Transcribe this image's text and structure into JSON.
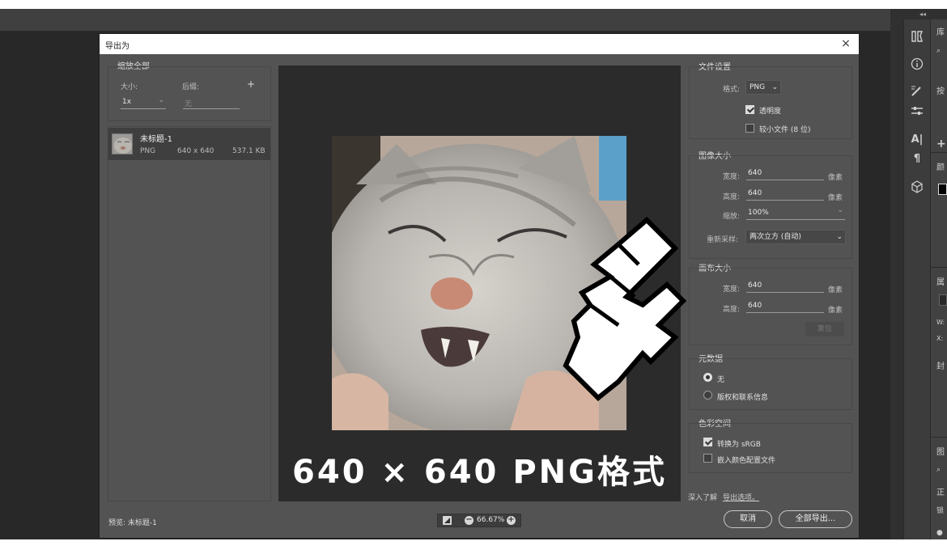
{
  "dialog": {
    "title": "导出为",
    "close": "×"
  },
  "left_panel": {
    "header": "缩放全部",
    "size_label": "大小:",
    "suffix_label": "后缀:",
    "add": "+",
    "scale_value": "1x",
    "suffix_value": "无",
    "asset": {
      "name": "未标题-1",
      "format": "PNG",
      "dimensions": "640 x 640",
      "filesize": "537.1 KB"
    }
  },
  "preview": {
    "label": "预览: 未标题-1",
    "zoom": "66.67%",
    "overlay": "640 × 640 PNG格式"
  },
  "file_settings": {
    "header": "文件设置",
    "format_label": "格式:",
    "format_value": "PNG",
    "transparency": "透明度",
    "smaller_file": "较小文件 (8 位)"
  },
  "image_size": {
    "header": "图像大小",
    "width_label": "宽度:",
    "width_value": "640",
    "height_label": "高度:",
    "height_value": "640",
    "scale_label": "缩放:",
    "scale_value": "100%",
    "unit": "像素",
    "resample_label": "重新采样:",
    "resample_value": "两次立方 (自动)"
  },
  "canvas_size": {
    "header": "画布大小",
    "width_label": "宽度:",
    "width_value": "640",
    "height_label": "高度:",
    "height_value": "640",
    "unit": "像素",
    "reset": "复位"
  },
  "metadata": {
    "header": "元数据",
    "none": "无",
    "copyright": "版权和联系信息"
  },
  "color_space": {
    "header": "色彩空间",
    "convert": "转换为 sRGB",
    "embed": "嵌入颜色配置文件"
  },
  "footer": {
    "learn_more": "深入了解",
    "export_options": "导出选项。",
    "cancel": "取消",
    "export_all": "全部导出..."
  },
  "right_dock": {
    "panel_labels": [
      "库",
      "按",
      "颜",
      "属",
      "W:",
      "X:",
      "封",
      "图",
      "正",
      "锁"
    ]
  },
  "icons": [
    "brush-settings-icon",
    "info-icon",
    "brushes-icon",
    "adjustments-icon",
    "character-icon",
    "paragraph-icon",
    "3d-cube-icon",
    "hand-cursor-icon",
    "minus-icon",
    "plus-icon",
    "preview-toggle-icon",
    "search-icon",
    "eye-icon"
  ],
  "colors": {
    "dialog_bg": "#535353",
    "canvas_bg": "#2b2b2b",
    "titlebar": "#ffffff",
    "workspace": "#282828"
  }
}
